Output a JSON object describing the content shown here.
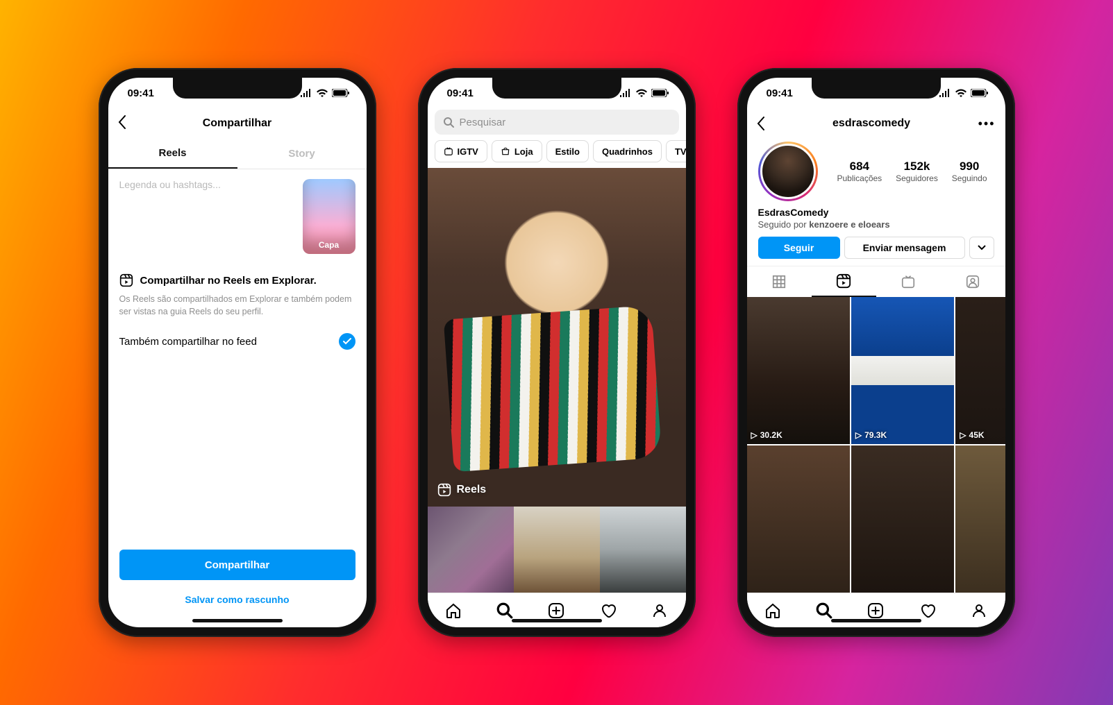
{
  "status": {
    "time": "09:41"
  },
  "phone1": {
    "header_title": "Compartilhar",
    "tabs": {
      "reels": "Reels",
      "story": "Story"
    },
    "caption_placeholder": "Legenda ou hashtags...",
    "cover_label": "Capa",
    "explore": {
      "title": "Compartilhar no Reels em Explorar.",
      "desc": "Os Reels são compartilhados em Explorar e também podem ser vistas na guia Reels do seu perfil."
    },
    "share_feed_label": "Também compartilhar no feed",
    "share_button": "Compartilhar",
    "draft_button": "Salvar como rascunho"
  },
  "phone2": {
    "search_placeholder": "Pesquisar",
    "chips": [
      "IGTV",
      "Loja",
      "Estilo",
      "Quadrinhos",
      "TV e cin"
    ],
    "reels_label": "Reels"
  },
  "phone3": {
    "username": "esdrascomedy",
    "stats": [
      {
        "num": "684",
        "lbl": "Publicações"
      },
      {
        "num": "152k",
        "lbl": "Seguidores"
      },
      {
        "num": "990",
        "lbl": "Seguindo"
      }
    ],
    "display_name": "EsdrasComedy",
    "followed_prefix": "Seguido por ",
    "followed_bold": "kenzoere e eloears",
    "follow_button": "Seguir",
    "message_button": "Enviar mensagem",
    "reels_views": [
      "30.2K",
      "79.3K",
      "45K"
    ]
  }
}
